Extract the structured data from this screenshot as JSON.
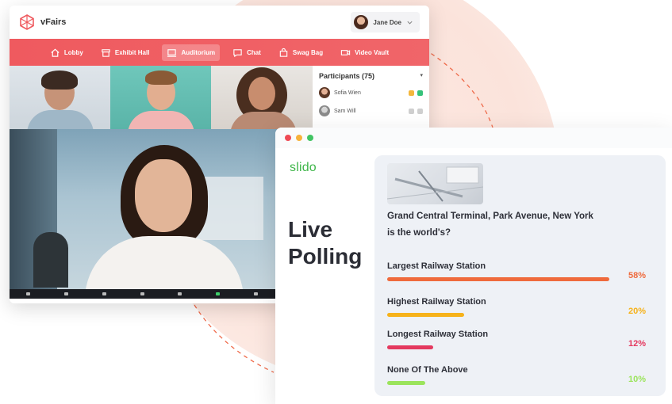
{
  "vfairs": {
    "brand": "vFairs",
    "user_name": "Jane Doe",
    "nav": [
      {
        "label": "Lobby",
        "icon": "home-icon",
        "active": false
      },
      {
        "label": "Exhibit Hall",
        "icon": "store-icon",
        "active": false
      },
      {
        "label": "Auditorium",
        "icon": "screen-icon",
        "active": true
      },
      {
        "label": "Chat",
        "icon": "chat-icon",
        "active": false
      },
      {
        "label": "Swag Bag",
        "icon": "bag-icon",
        "active": false
      },
      {
        "label": "Video Vault",
        "icon": "video-icon",
        "active": false
      }
    ],
    "participants": {
      "title": "Participants (75)",
      "list": [
        {
          "name": "Sofia Wien"
        },
        {
          "name": "Sam Will"
        }
      ]
    }
  },
  "slido": {
    "logo": "slido",
    "title_line1": "Live",
    "title_line2": "Polling",
    "question_line1": "Grand Central Terminal, Park Avenue, New York",
    "question_line2": "is the world's?",
    "options": [
      {
        "label": "Largest Railway Station",
        "percent": 58,
        "percent_text": "58%",
        "color": "#ef6a3c"
      },
      {
        "label": "Highest Railway Station",
        "percent": 20,
        "percent_text": "20%",
        "color": "#f6b21a"
      },
      {
        "label": "Longest Railway Station",
        "percent": 12,
        "percent_text": "12%",
        "color": "#e4395f"
      },
      {
        "label": "None Of The Above",
        "percent": 10,
        "percent_text": "10%",
        "color": "#9be45c"
      }
    ]
  },
  "colors": {
    "nav_bg": "#ef5a5f",
    "slido_green": "#3fb64a",
    "bg_circle": "#fbe3db"
  }
}
